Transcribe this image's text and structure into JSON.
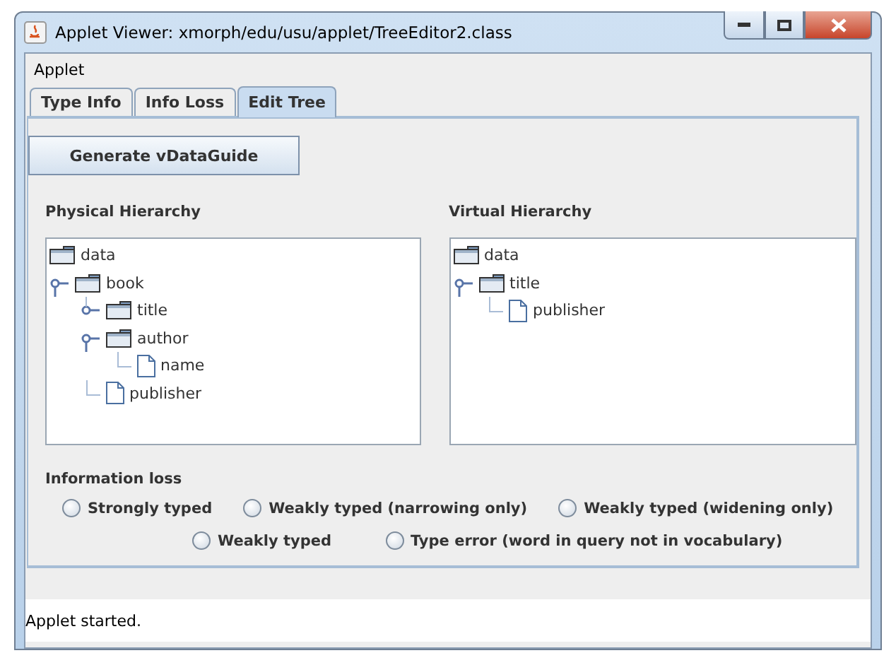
{
  "window": {
    "title": "Applet Viewer: xmorph/edu/usu/applet/TreeEditor2.class"
  },
  "menu": [
    "Applet"
  ],
  "tabs": [
    {
      "label": "Type Info",
      "selected": false
    },
    {
      "label": "Info Loss",
      "selected": false
    },
    {
      "label": "Edit Tree",
      "selected": true
    }
  ],
  "generate_button": "Generate vDataGuide",
  "trees": [
    {
      "title": "Physical Hierarchy",
      "root": {
        "label": "data",
        "children": [
          {
            "label": "book",
            "kind": "folder",
            "expanded": true,
            "children": [
              {
                "label": "title",
                "kind": "folder",
                "expanded": false
              },
              {
                "label": "author",
                "kind": "folder",
                "expanded": true,
                "children": [
                  {
                    "label": "name",
                    "kind": "file"
                  }
                ]
              },
              {
                "label": "publisher",
                "kind": "file"
              }
            ]
          }
        ]
      }
    },
    {
      "title": "Virtual Hierarchy",
      "root": {
        "label": "data",
        "children": [
          {
            "label": "title",
            "kind": "folder",
            "expanded": true,
            "children": [
              {
                "label": "publisher",
                "kind": "file"
              }
            ]
          }
        ]
      }
    }
  ],
  "information_loss": {
    "title": "Information loss",
    "rows": [
      [
        {
          "label": "Strongly typed",
          "selected": false
        },
        {
          "label": "Weakly typed (narrowing only)",
          "selected": false
        },
        {
          "label": "Weakly typed (widening only)",
          "selected": false
        }
      ],
      [
        {
          "label": "Weakly typed",
          "selected": false
        },
        {
          "label": "Type error (word in query not in vocabulary)",
          "selected": false
        }
      ]
    ]
  },
  "status_bar": "Applet started."
}
